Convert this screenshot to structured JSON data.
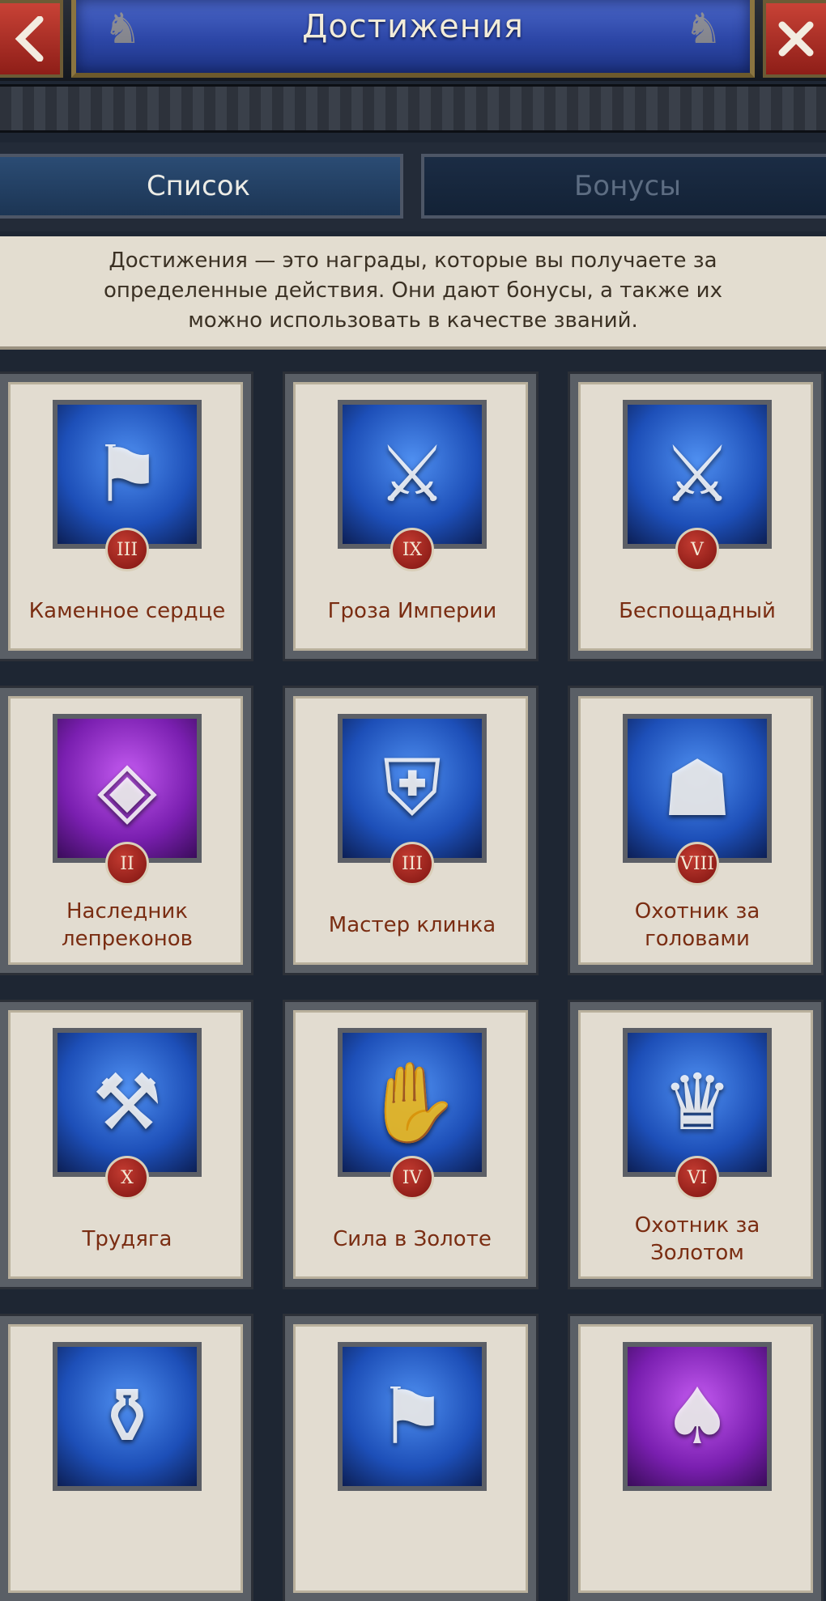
{
  "header": {
    "title": "Достижения",
    "back_icon": "chevron-left-icon",
    "close_icon": "close-icon"
  },
  "tabs": [
    {
      "label": "Список",
      "active": true
    },
    {
      "label": "Бонусы",
      "active": false
    }
  ],
  "description": "Достижения — это награды, которые вы получаете за определенные действия. Они дают бонусы, а также их можно использовать в качестве званий.",
  "achievements": [
    {
      "name": "Каменное сердце",
      "rank": "III",
      "icon": "helmet-banner-icon",
      "bg": "#1d4fb8"
    },
    {
      "name": "Гроза Империи",
      "rank": "IX",
      "icon": "helmet-axe-icon",
      "bg": "#1d4fb8"
    },
    {
      "name": "Беспощадный",
      "rank": "V",
      "icon": "helmet-sword-icon",
      "bg": "#1d4fb8"
    },
    {
      "name": "Наследник лепреконов",
      "rank": "II",
      "icon": "rainbow-shield-icon",
      "bg": "#7a1fb0"
    },
    {
      "name": "Мастер клинка",
      "rank": "III",
      "icon": "sword-shield-icon",
      "bg": "#1d4fb8"
    },
    {
      "name": "Охотник за головами",
      "rank": "VIII",
      "icon": "hooded-assassin-icon",
      "bg": "#1d4fb8"
    },
    {
      "name": "Трудяга",
      "rank": "X",
      "icon": "shovel-pickaxe-icon",
      "bg": "#1d4fb8"
    },
    {
      "name": "Сила в Золоте",
      "rank": "IV",
      "icon": "hand-coins-icon",
      "bg": "#1d4fb8"
    },
    {
      "name": "Охотник за Золотом",
      "rank": "VI",
      "icon": "treasure-chest-icon",
      "bg": "#1d4fb8"
    },
    {
      "name": "",
      "rank": "",
      "icon": "coin-sack-icon",
      "bg": "#1d4fb8"
    },
    {
      "name": "",
      "rank": "",
      "icon": "banner-sword-icon",
      "bg": "#1d4fb8"
    },
    {
      "name": "",
      "rank": "",
      "icon": "feathered-hat-icon",
      "bg": "#7a1fb0"
    }
  ],
  "colors": {
    "accent_red": "#a9291f",
    "title_text": "#f2ecd9",
    "achievement_name": "#7a2d12",
    "parchment": "#e2dcd0",
    "banner_blue": "#2c46a6"
  }
}
